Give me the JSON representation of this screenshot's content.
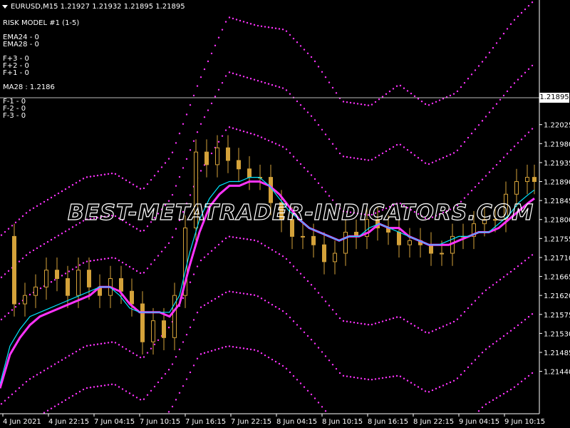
{
  "header": {
    "title": "EURUSD,M15  1.21927 1.21932 1.21895 1.21895",
    "lines": [
      "RISK MODEL #1 (1-5)",
      "",
      "EMA24 - 0",
      "EMA28 - 0",
      "",
      "F+3 - 0",
      "F+2 - 0",
      "F+1 - 0",
      "",
      "MA28 : 1.2186",
      "",
      "F-1 - 0",
      "F-2 - 0",
      "F-3 - 0"
    ]
  },
  "watermark": "BEST-METATRADER-INDICATORS.COM",
  "current_price_label": "1.21895",
  "colors": {
    "background": "#000000",
    "candle": "#d4a23a",
    "ema_fast": "#00e5ff",
    "ma28": "#ff33ff",
    "bands": "#ff33ff",
    "grid_line": "#bdbdbd",
    "text": "#ffffff"
  },
  "chart_data": {
    "type": "line",
    "symbol": "EURUSD",
    "timeframe": "M15",
    "ylim": [
      1.2137,
      1.2229
    ],
    "y_ticks": [
      "1.22025",
      "1.21980",
      "1.21935",
      "1.21890",
      "1.21845",
      "1.21800",
      "1.21755",
      "1.21710",
      "1.21665",
      "1.21620",
      "1.21575",
      "1.21530",
      "1.21485",
      "1.21440"
    ],
    "x_ticks": [
      "4 Jun 2021",
      "4 Jun 22:15",
      "7 Jun 04:15",
      "7 Jun 10:15",
      "7 Jun 16:15",
      "7 Jun 22:15",
      "8 Jun 04:15",
      "8 Jun 10:15",
      "8 Jun 16:15",
      "8 Jun 22:15",
      "9 Jun 04:15",
      "9 Jun 10:15"
    ],
    "current_price": 1.21895,
    "series": [
      {
        "name": "MA28",
        "x": [
          0,
          14,
          28,
          42,
          56,
          70,
          84,
          98,
          112,
          126,
          140,
          154,
          168,
          182,
          196,
          210,
          224,
          238,
          252,
          266,
          280,
          294,
          308,
          322,
          336,
          350,
          364,
          378,
          392,
          406,
          420,
          434,
          448,
          462,
          476,
          490,
          504,
          518,
          532,
          546,
          560,
          574,
          588,
          602,
          616,
          630,
          644,
          658,
          672,
          686,
          700,
          714,
          728,
          742,
          750
        ],
        "values": [
          1.214,
          1.2148,
          1.2152,
          1.2155,
          1.2157,
          1.2158,
          1.2159,
          1.216,
          1.2161,
          1.2162,
          1.2164,
          1.2164,
          1.2163,
          1.216,
          1.2158,
          1.2158,
          1.2158,
          1.2157,
          1.216,
          1.2169,
          1.2177,
          1.2183,
          1.2186,
          1.2188,
          1.2188,
          1.2189,
          1.2189,
          1.2188,
          1.2186,
          1.2183,
          1.218,
          1.2178,
          1.2177,
          1.2176,
          1.2175,
          1.2176,
          1.2176,
          1.2177,
          1.2179,
          1.2178,
          1.2178,
          1.2176,
          1.2175,
          1.2174,
          1.2174,
          1.2174,
          1.2175,
          1.2176,
          1.2177,
          1.2177,
          1.2178,
          1.218,
          1.2182,
          1.2184,
          1.2185
        ]
      },
      {
        "name": "EMA24",
        "x": [
          0,
          14,
          28,
          42,
          56,
          70,
          84,
          98,
          112,
          126,
          140,
          154,
          168,
          182,
          196,
          210,
          224,
          238,
          252,
          266,
          280,
          294,
          308,
          322,
          336,
          350,
          364,
          378,
          392,
          406,
          420,
          434,
          448,
          462,
          476,
          490,
          504,
          518,
          532,
          546,
          560,
          574,
          588,
          602,
          616,
          630,
          644,
          658,
          672,
          686,
          700,
          714,
          728,
          742,
          750
        ],
        "values": [
          1.2141,
          1.215,
          1.2154,
          1.2157,
          1.2158,
          1.2159,
          1.216,
          1.2161,
          1.2162,
          1.2163,
          1.2164,
          1.2164,
          1.2162,
          1.2159,
          1.2158,
          1.2158,
          1.2158,
          1.2158,
          1.2162,
          1.2172,
          1.218,
          1.2185,
          1.2188,
          1.2189,
          1.2189,
          1.219,
          1.219,
          1.2188,
          1.2185,
          1.2182,
          1.218,
          1.2178,
          1.2177,
          1.2176,
          1.2175,
          1.2176,
          1.2176,
          1.2178,
          1.2179,
          1.2178,
          1.2177,
          1.2176,
          1.2175,
          1.2174,
          1.2174,
          1.2175,
          1.2176,
          1.2176,
          1.2177,
          1.2177,
          1.2179,
          1.2181,
          1.2184,
          1.2186,
          1.2187
        ]
      },
      {
        "name": "F+3",
        "x": [
          0,
          40,
          80,
          120,
          160,
          200,
          240,
          280,
          320,
          360,
          400,
          440,
          480,
          520,
          560,
          600,
          640,
          680,
          720,
          750
        ],
        "values": [
          1.2176,
          1.2182,
          1.2186,
          1.219,
          1.2191,
          1.2187,
          1.2195,
          1.2213,
          1.2228,
          1.2226,
          1.2225,
          1.2218,
          1.2208,
          1.2207,
          1.2212,
          1.2207,
          1.221,
          1.2218,
          1.2227,
          1.2232
        ]
      },
      {
        "name": "F+2",
        "x": [
          0,
          40,
          80,
          120,
          160,
          200,
          240,
          280,
          320,
          360,
          400,
          440,
          480,
          520,
          560,
          600,
          640,
          680,
          720,
          750
        ],
        "values": [
          1.2166,
          1.2172,
          1.2176,
          1.218,
          1.2181,
          1.2177,
          1.2185,
          1.2202,
          1.2215,
          1.2213,
          1.2211,
          1.2204,
          1.2195,
          1.2194,
          1.2198,
          1.2193,
          1.2196,
          1.2204,
          1.2212,
          1.2217
        ]
      },
      {
        "name": "F+1",
        "x": [
          0,
          40,
          80,
          120,
          160,
          200,
          240,
          280,
          320,
          360,
          400,
          440,
          480,
          520,
          560,
          600,
          640,
          680,
          720,
          750
        ],
        "values": [
          1.2156,
          1.2162,
          1.2166,
          1.217,
          1.2171,
          1.2167,
          1.2175,
          1.2191,
          1.2202,
          1.22,
          1.2197,
          1.219,
          1.2182,
          1.2181,
          1.2184,
          1.218,
          1.2183,
          1.219,
          1.2197,
          1.2202
        ]
      },
      {
        "name": "F-1",
        "x": [
          0,
          40,
          80,
          120,
          160,
          200,
          240,
          280,
          320,
          360,
          400,
          440,
          480,
          520,
          560,
          600,
          640,
          680,
          720,
          750
        ],
        "values": [
          1.2136,
          1.2142,
          1.2146,
          1.215,
          1.2151,
          1.2147,
          1.2155,
          1.217,
          1.2176,
          1.2175,
          1.2171,
          1.2164,
          1.2156,
          1.2155,
          1.2157,
          1.2153,
          1.2156,
          1.2163,
          1.2168,
          1.2172
        ]
      },
      {
        "name": "F-2",
        "x": [
          0,
          40,
          80,
          120,
          160,
          200,
          240,
          280,
          320,
          360,
          400,
          440,
          480,
          520,
          560,
          600,
          640,
          680,
          720,
          750
        ],
        "values": [
          1.2126,
          1.2132,
          1.2136,
          1.214,
          1.2141,
          1.2137,
          1.2145,
          1.2159,
          1.2163,
          1.2162,
          1.2158,
          1.2151,
          1.2143,
          1.2142,
          1.2143,
          1.2139,
          1.2142,
          1.2149,
          1.2154,
          1.2158
        ]
      },
      {
        "name": "F-3",
        "x": [
          0,
          40,
          80,
          120,
          160,
          200,
          240,
          280,
          320,
          360,
          400,
          440,
          480,
          520,
          560,
          600,
          640,
          680,
          720,
          750
        ],
        "values": [
          1.2116,
          1.2122,
          1.2126,
          1.213,
          1.2131,
          1.2127,
          1.2135,
          1.2148,
          1.215,
          1.2149,
          1.2145,
          1.2138,
          1.213,
          1.2129,
          1.213,
          1.2126,
          1.2129,
          1.2136,
          1.214,
          1.2144
        ]
      }
    ],
    "candles": {
      "x": [
        5,
        20,
        35,
        50,
        65,
        80,
        95,
        110,
        125,
        140,
        155,
        170,
        185,
        200,
        215,
        230,
        245,
        260,
        275,
        290,
        305,
        320,
        335,
        350,
        365,
        380,
        395,
        410,
        425,
        440,
        455,
        470,
        485,
        500,
        515,
        530,
        545,
        560,
        575,
        590,
        605,
        620,
        635,
        650,
        665,
        680,
        695,
        710,
        725,
        740,
        750
      ],
      "close": [
        1.2176,
        1.216,
        1.2162,
        1.2164,
        1.2168,
        1.2166,
        1.2162,
        1.2168,
        1.2164,
        1.2162,
        1.2166,
        1.2163,
        1.216,
        1.2151,
        1.2156,
        1.2152,
        1.2162,
        1.2178,
        1.2196,
        1.2193,
        1.2197,
        1.2194,
        1.2192,
        1.219,
        1.219,
        1.2184,
        1.218,
        1.2176,
        1.2176,
        1.2174,
        1.217,
        1.2172,
        1.2177,
        1.2176,
        1.218,
        1.2178,
        1.2177,
        1.2174,
        1.2175,
        1.2174,
        1.2172,
        1.2172,
        1.2176,
        1.2176,
        1.2179,
        1.218,
        1.218,
        1.2186,
        1.2189,
        1.219,
        1.2189
      ]
    }
  }
}
